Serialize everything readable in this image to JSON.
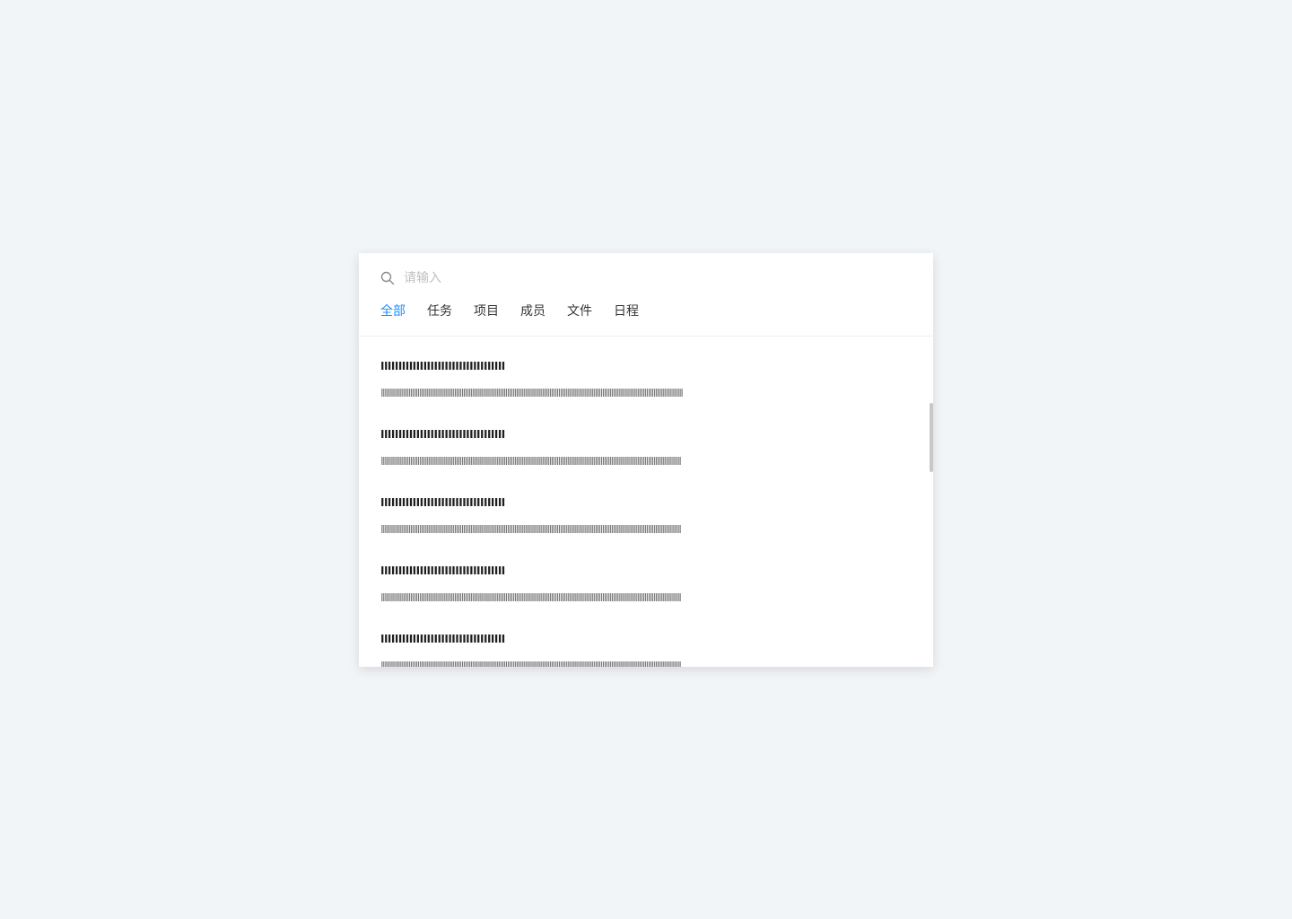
{
  "search": {
    "placeholder": "请输入",
    "value": ""
  },
  "tabs": [
    {
      "label": "全部",
      "active": true
    },
    {
      "label": "任务",
      "active": false
    },
    {
      "label": "项目",
      "active": false
    },
    {
      "label": "成员",
      "active": false
    },
    {
      "label": "文件",
      "active": false
    },
    {
      "label": "日程",
      "active": false
    }
  ],
  "results": [
    {
      "title": "IIIIIIIIIIIIIIIIIIIIIIIIIIIIIIIIIII",
      "description": "IIIIIIIIIIIIIIIIIIIIIIIIIIIIIIIIIIIIIIIIIIIIIIIIIIIIIIIIIIIIIIIIIIIIIIIIIIIIIIIIIIIIIIIIIIIIIIIIIIIIIIIIIIIIIIIIIIIIIIIIIIIIIIIIIIIIIIIIIIIIIIIIIIIIIIIIIIIIIIIIIIIII"
    },
    {
      "title": "IIIIIIIIIIIIIIIIIIIIIIIIIIIIIIIIIII",
      "description": "IIIIIIIIIIIIIIIIIIIIIIIIIIIIIIIIIIIIIIIIIIIIIIIIIIIIIIIIIIIIIIIIIIIIIIIIIIIIIIIIIIIIIIIIIIIIIIIIIIIIIIIIIIIIIIIIIIIIIIIIIIIIIIIIIIIIIIIIIIIIIIIIIIIIIIIIIIIIIIIIIIII"
    },
    {
      "title": "IIIIIIIIIIIIIIIIIIIIIIIIIIIIIIIIIII",
      "description": "IIIIIIIIIIIIIIIIIIIIIIIIIIIIIIIIIIIIIIIIIIIIIIIIIIIIIIIIIIIIIIIIIIIIIIIIIIIIIIIIIIIIIIIIIIIIIIIIIIIIIIIIIIIIIIIIIIIIIIIIIIIIIIIIIIIIIIIIIIIIIIIIIIIIIIIIIIIIIIIIIIII"
    },
    {
      "title": "IIIIIIIIIIIIIIIIIIIIIIIIIIIIIIIIIII",
      "description": "IIIIIIIIIIIIIIIIIIIIIIIIIIIIIIIIIIIIIIIIIIIIIIIIIIIIIIIIIIIIIIIIIIIIIIIIIIIIIIIIIIIIIIIIIIIIIIIIIIIIIIIIIIIIIIIIIIIIIIIIIIIIIIIIIIIIIIIIIIIIIIIIIIIIIIIIIIIIIIIIIIII"
    },
    {
      "title": "IIIIIIIIIIIIIIIIIIIIIIIIIIIIIIIIIII",
      "description": "IIIIIIIIIIIIIIIIIIIIIIIIIIIIIIIIIIIIIIIIIIIIIIIIIIIIIIIIIIIIIIIIIIIIIIIIIIIIIIIIIIIIIIIIIIIIIIIIIIIIIIIIIIIIIIIIIIIIIIIIIIIIIIIIIIIIIIIIIIIIIIIIIIIIIIIIIIIIIIIIIIII"
    }
  ],
  "icons": {
    "search": "search-icon"
  },
  "colors": {
    "accent": "#1890ff",
    "background": "#f2f5f8",
    "panel": "#ffffff",
    "text": "#333333",
    "placeholder": "#c0c0c0"
  }
}
